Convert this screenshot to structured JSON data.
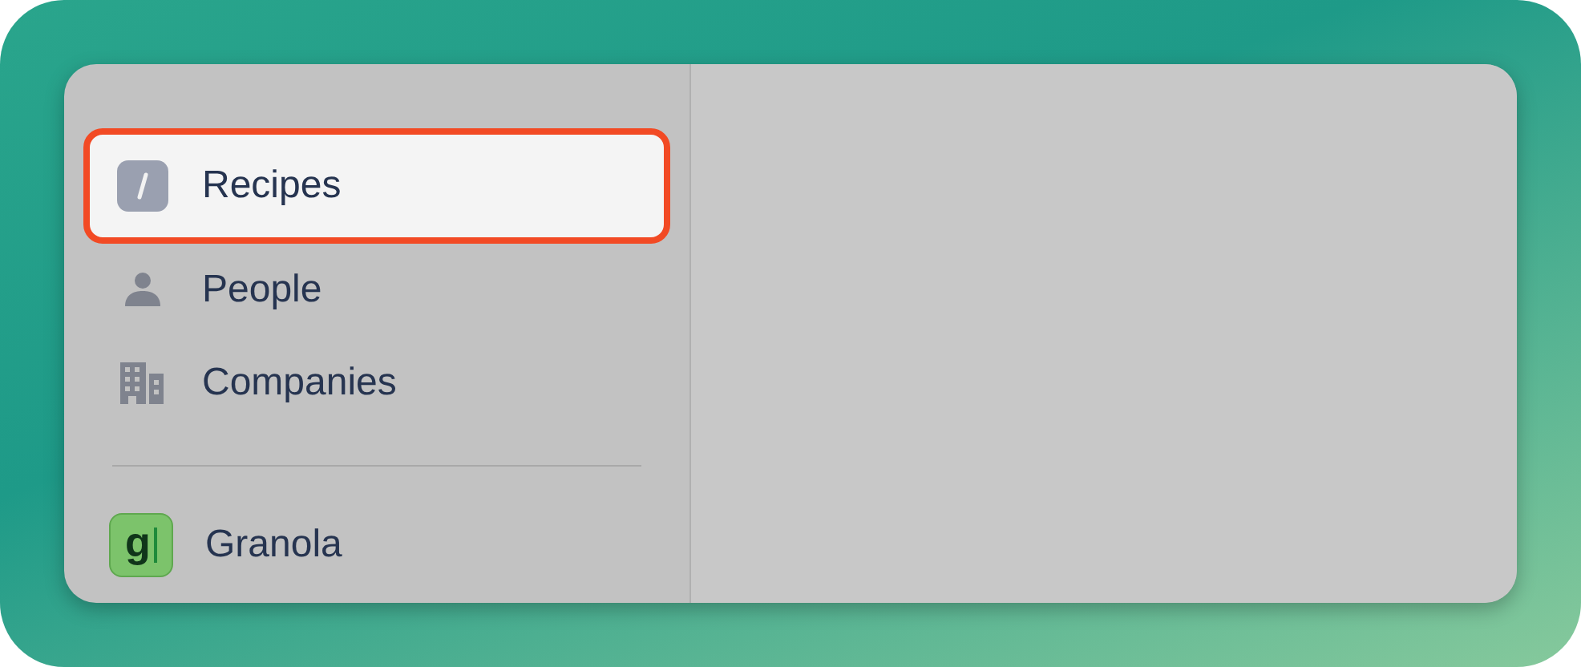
{
  "sidebar": {
    "items": [
      {
        "kind": "slash",
        "label": "Recipes",
        "selected": true
      },
      {
        "kind": "person",
        "label": "People",
        "selected": false
      },
      {
        "kind": "building",
        "label": "Companies",
        "selected": false
      }
    ],
    "apps": [
      {
        "logo_text": "g",
        "label": "Granola",
        "selected": false
      }
    ]
  }
}
